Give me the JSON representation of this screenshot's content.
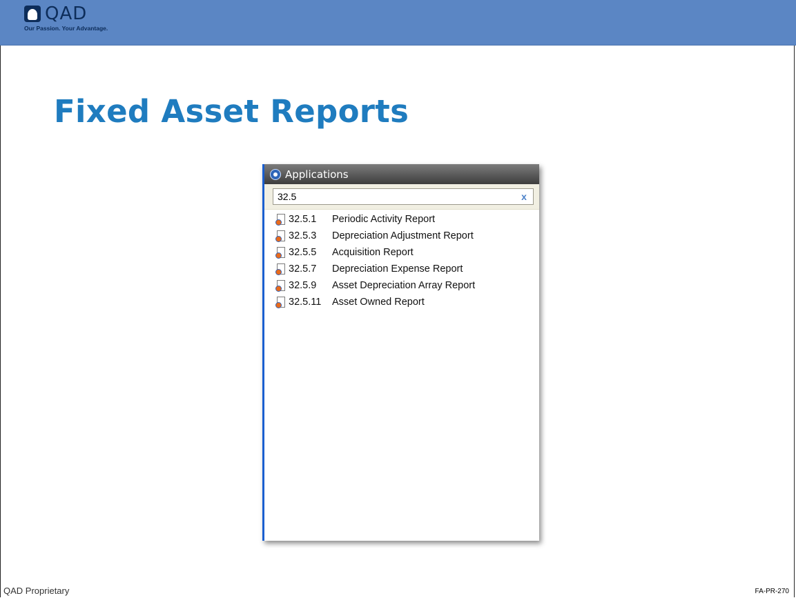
{
  "header": {
    "logo_text": "QAD",
    "tagline": "Our Passion. Your Advantage."
  },
  "slide": {
    "title": "Fixed Asset Reports"
  },
  "applications_panel": {
    "title": "Applications",
    "search": {
      "value": "32.5",
      "clear_label": "x"
    },
    "items": [
      {
        "code": "32.5.1",
        "label": "Periodic Activity Report"
      },
      {
        "code": "32.5.3",
        "label": "Depreciation Adjustment Report"
      },
      {
        "code": "32.5.5",
        "label": "Acquisition Report"
      },
      {
        "code": "32.5.7",
        "label": "Depreciation Expense Report"
      },
      {
        "code": "32.5.9",
        "label": "Asset Depreciation Array Report"
      },
      {
        "code": "32.5.11",
        "label": "Asset Owned Report"
      }
    ]
  },
  "footer": {
    "left": "QAD Proprietary",
    "right": "FA-PR-270"
  },
  "colors": {
    "header_bar": "#5b86c4",
    "title": "#1f7cbf",
    "panel_accent": "#1a5fd0",
    "logo": "#0d2d5a"
  }
}
